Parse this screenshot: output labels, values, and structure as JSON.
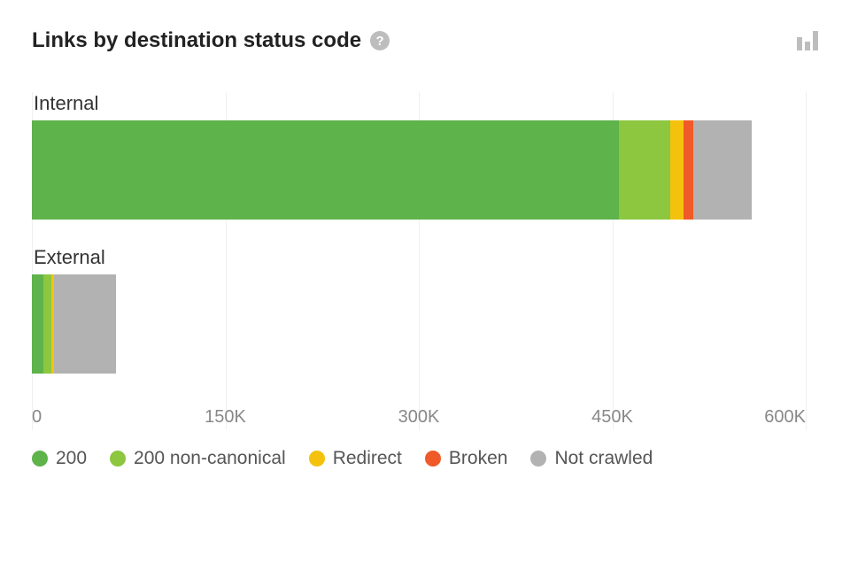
{
  "title": "Links by destination status code",
  "help_icon": "?",
  "chart_data": {
    "type": "bar",
    "orientation": "horizontal",
    "stacked": true,
    "xlabel": "",
    "ylabel": "",
    "xlim": [
      0,
      600000
    ],
    "ticks": [
      {
        "value": 0,
        "label": "0"
      },
      {
        "value": 150000,
        "label": "150K"
      },
      {
        "value": 300000,
        "label": "300K"
      },
      {
        "value": 450000,
        "label": "450K"
      },
      {
        "value": 600000,
        "label": "600K"
      }
    ],
    "categories": [
      "Internal",
      "External"
    ],
    "series": [
      {
        "name": "200",
        "color": "#5eb34b",
        "values": [
          455000,
          9000
        ]
      },
      {
        "name": "200 non-canonical",
        "color": "#8dc63f",
        "values": [
          40000,
          6000
        ]
      },
      {
        "name": "Redirect",
        "color": "#f4c20d",
        "values": [
          10000,
          2000
        ]
      },
      {
        "name": "Broken",
        "color": "#f05a28",
        "values": [
          8000,
          0
        ]
      },
      {
        "name": "Not crawled",
        "color": "#b2b2b2",
        "values": [
          45000,
          48000
        ]
      }
    ]
  }
}
